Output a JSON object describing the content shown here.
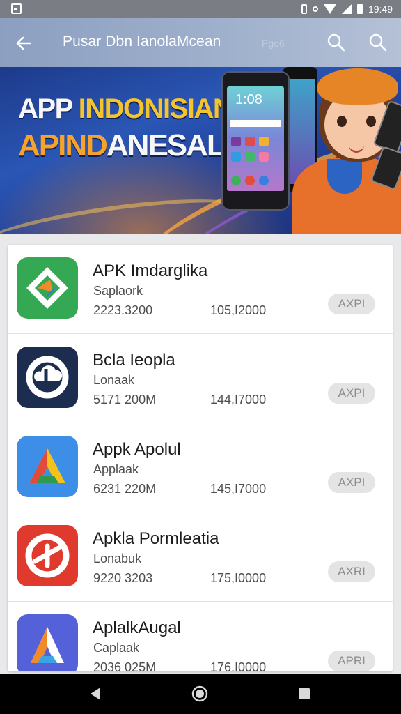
{
  "status_bar": {
    "time": "19:49"
  },
  "app_bar": {
    "title": "Pusar Dbn IanolaMcean",
    "faint_text": "Pgo6"
  },
  "banner": {
    "line1_white": "APP",
    "line1_yellow": "INDONISIAN",
    "line2_orange": "APIND",
    "line2_white": "ANESAL",
    "phone_time": "1:08"
  },
  "apps": [
    {
      "name": "APK Imdarglika",
      "developer": "Saplaork",
      "size": "2223.3200",
      "downloads": "105,I2000",
      "button": "AXPI",
      "icon": "green-diamond-icon",
      "color": "#35a854"
    },
    {
      "name": "Bcla Ieopla",
      "developer": "Lonaak",
      "size": "5171 200M",
      "downloads": "144,I7000",
      "button": "AXPI",
      "icon": "cloud-ring-icon",
      "color": "#1d2d4f"
    },
    {
      "name": "Appk Apolul",
      "developer": "Applaak",
      "size": "6231 220M",
      "downloads": "145,I7000",
      "button": "AXPI",
      "icon": "tricolor-a-icon",
      "color": "#3d8ee6"
    },
    {
      "name": "Apkla Pormleatia",
      "developer": "Lonabuk",
      "size": "9220 3203",
      "downloads": "175,I0000",
      "button": "AXRI",
      "icon": "red-ring-icon",
      "color": "#e03a2f"
    },
    {
      "name": "AplalkAugal",
      "developer": "Caplaak",
      "size": "2036 025M",
      "downloads": "176,I0000",
      "button": "APRI",
      "icon": "purple-a-icon",
      "color": "#5561d8"
    }
  ]
}
